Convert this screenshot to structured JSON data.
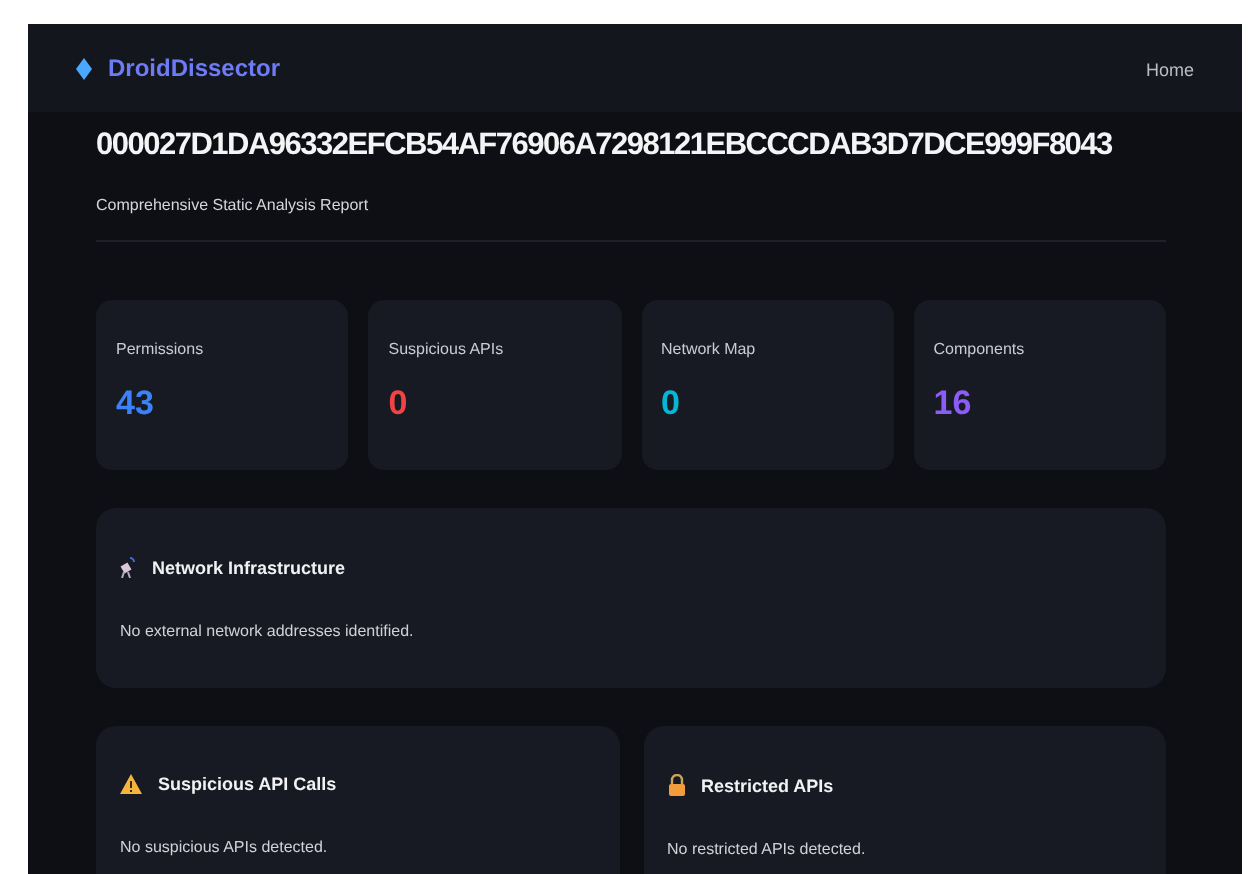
{
  "navbar": {
    "brand": "DroidDissector",
    "links": [
      "Home"
    ]
  },
  "header": {
    "title": "000027D1DA96332EFCB54AF76906A7298121EBCCCDAB3D7DCE999F8043",
    "subtitle": "Comprehensive Static Analysis Report"
  },
  "stats": [
    {
      "label": "Permissions",
      "value": "43",
      "color": "#3b82f6"
    },
    {
      "label": "Suspicious APIs",
      "value": "0",
      "color": "#ef4444"
    },
    {
      "label": "Network Map",
      "value": "0",
      "color": "#06b6d4"
    },
    {
      "label": "Components",
      "value": "16",
      "color": "#8b5cf6"
    }
  ],
  "network_panel": {
    "title": "Network Infrastructure",
    "message": "No external network addresses identified."
  },
  "panels": [
    {
      "kind": "warning",
      "title": "Suspicious API Calls",
      "message": "No suspicious APIs detected."
    },
    {
      "kind": "lock",
      "title": "Restricted APIs",
      "message": "No restricted APIs detected."
    }
  ]
}
